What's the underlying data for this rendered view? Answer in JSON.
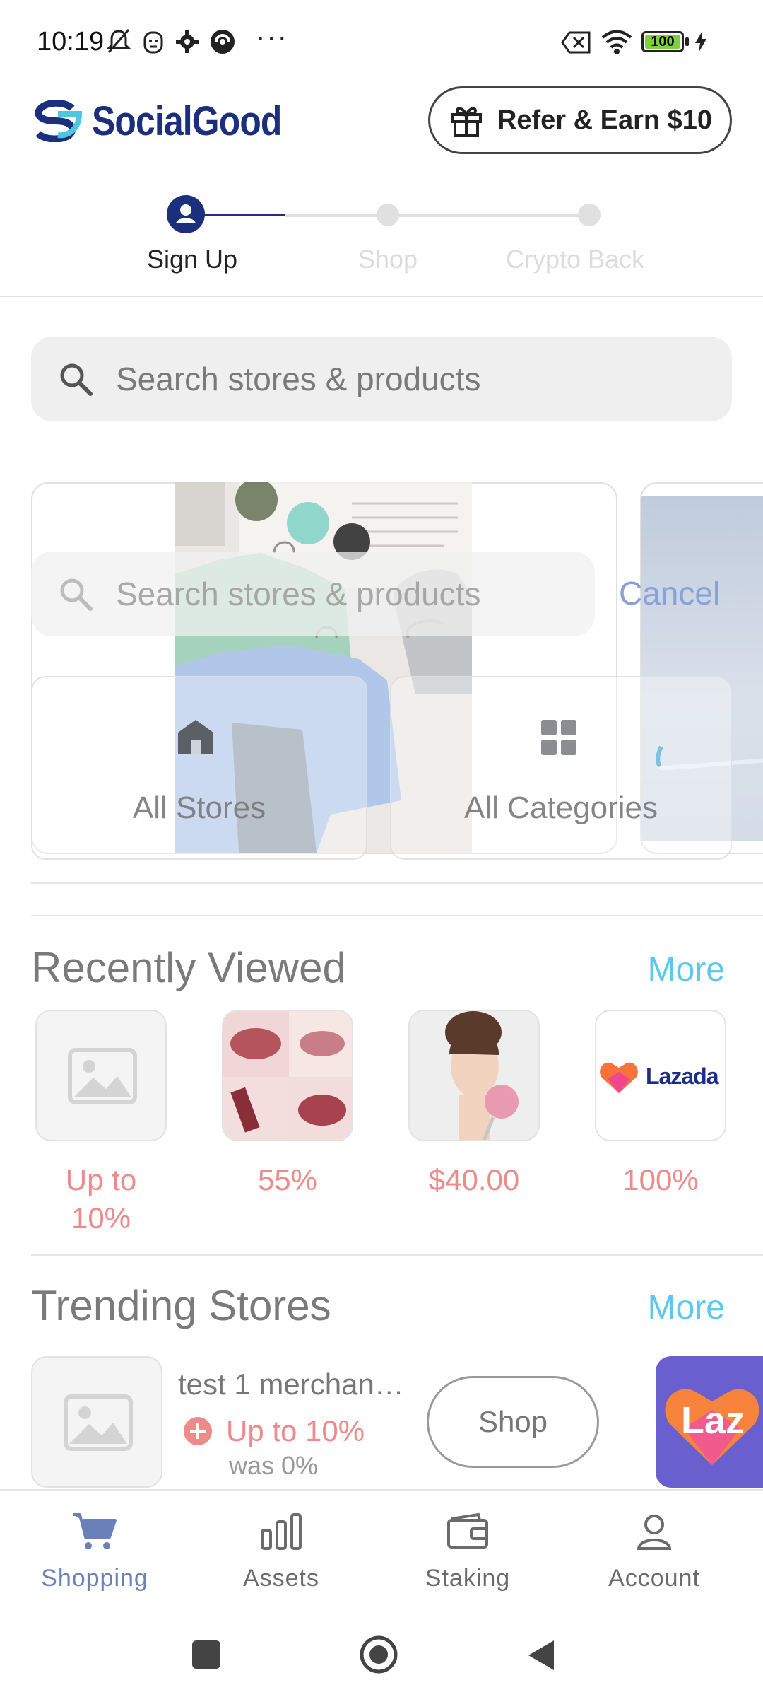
{
  "status_bar": {
    "time": "10:19",
    "battery": "100",
    "icons": [
      "mute-bell-icon",
      "face-icon",
      "gear-icon",
      "vpn-icon",
      "more-dots-icon",
      "sim-off-icon",
      "wifi-icon",
      "battery-icon",
      "charging-icon"
    ]
  },
  "header": {
    "brand": "SocialGood",
    "refer_label": "Refer & Earn $10"
  },
  "stepper": {
    "steps": [
      {
        "label": "Sign Up",
        "active": true
      },
      {
        "label": "Shop",
        "active": false
      },
      {
        "label": "Crypto Back",
        "active": false
      }
    ]
  },
  "search": {
    "placeholder": "Search stores & products"
  },
  "overlay": {
    "search_placeholder": "Search stores & products",
    "cancel_label": "Cancel",
    "quick_links": [
      {
        "label": "All Stores",
        "icon": "store-icon"
      },
      {
        "label": "All Categories",
        "icon": "grid-icon"
      }
    ]
  },
  "recently_viewed": {
    "title": "Recently Viewed",
    "more_label": "More",
    "items": [
      {
        "value": "Up to 10%",
        "thumb": "placeholder-image-icon"
      },
      {
        "value": "55%",
        "thumb": "lip-tint-photo"
      },
      {
        "value": "$40.00",
        "thumb": "portrait-photo"
      },
      {
        "value": "100%",
        "thumb": "lazada-logo",
        "logo_text": "Lazada"
      }
    ]
  },
  "trending_stores": {
    "title": "Trending Stores",
    "more_label": "More",
    "stores": [
      {
        "name": "test 1 merchan…",
        "cashback": "Up to 10%",
        "was": "was 0%",
        "shop_label": "Shop",
        "thumb": "placeholder-image-icon"
      }
    ],
    "next_card_text": "Laz"
  },
  "bottom_nav": {
    "items": [
      {
        "label": "Shopping",
        "icon": "cart-icon",
        "active": true
      },
      {
        "label": "Assets",
        "icon": "bar-chart-icon",
        "active": false
      },
      {
        "label": "Staking",
        "icon": "wallet-icon",
        "active": false
      },
      {
        "label": "Account",
        "icon": "person-icon",
        "active": false
      }
    ]
  },
  "colors": {
    "brand": "#1b2f7c",
    "accent_link": "#5cc8f0",
    "cashback": "#ef8a8a",
    "active_nav": "#6b80b8"
  }
}
